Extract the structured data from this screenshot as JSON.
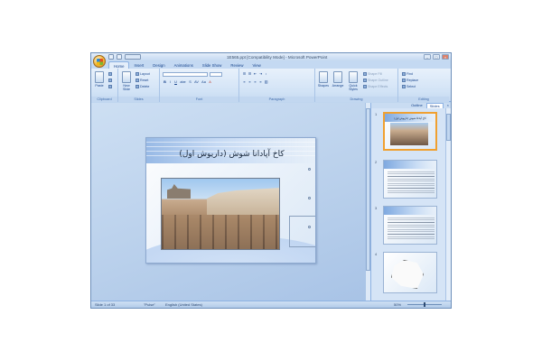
{
  "app": {
    "title": "1E565.ppt [Compatibility Mode] - Microsoft PowerPoint",
    "window_controls": [
      "–",
      "□",
      "×"
    ]
  },
  "tabs": [
    "Home",
    "Insert",
    "Design",
    "Animations",
    "Slide Show",
    "Review",
    "View"
  ],
  "active_tab": "Home",
  "ribbon": {
    "clipboard": {
      "label": "Clipboard",
      "paste": "Paste"
    },
    "slides": {
      "label": "Slides",
      "new_slide": "New Slide",
      "layout": "Layout",
      "reset": "Reset",
      "delete": "Delete"
    },
    "font": {
      "label": "Font",
      "bold": "B",
      "italic": "I",
      "underline": "U",
      "strike": "abe",
      "shadow": "S",
      "spacing": "AV",
      "case": "Aa",
      "color": "A"
    },
    "paragraph": {
      "label": "Paragraph"
    },
    "drawing": {
      "label": "Drawing",
      "shapes": "Shapes",
      "arrange": "Arrange",
      "quick_styles": "Quick Styles",
      "shape_fill": "Shape Fill",
      "shape_outline": "Shape Outline",
      "shape_effects": "Shape Effects"
    },
    "editing": {
      "label": "Editing",
      "find": "Find",
      "replace": "Replace",
      "select": "Select"
    }
  },
  "slide": {
    "title": "کاخ آپادانا شوش (داریوش اول)"
  },
  "pane": {
    "tab_outline": "Outline",
    "tab_slides": "Slides",
    "close": "×",
    "thumbnails": [
      {
        "number": "1",
        "title": "کاخ آپادانا شوش (داریوش اول)"
      },
      {
        "number": "2",
        "title": ""
      },
      {
        "number": "3",
        "title": ""
      },
      {
        "number": "4",
        "title": ""
      }
    ]
  },
  "status": {
    "slide_info": "Slide 1 of 33",
    "theme": "\"Pulse\"",
    "language": "English (United States)",
    "zoom": "50%"
  }
}
